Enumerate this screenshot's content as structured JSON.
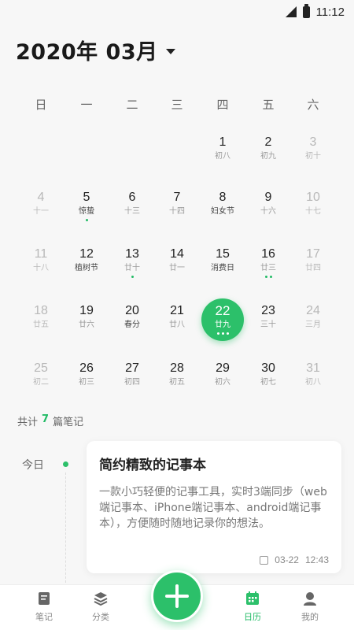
{
  "status_bar": {
    "time": "11:12"
  },
  "header": {
    "month_title": "2020年 03月"
  },
  "weekdays": [
    "日",
    "一",
    "二",
    "三",
    "四",
    "五",
    "六"
  ],
  "calendar": [
    [
      null,
      null,
      null,
      null,
      {
        "day": "1",
        "lunar": "初八",
        "muted": false,
        "dots": 0
      },
      {
        "day": "2",
        "lunar": "初九",
        "muted": false,
        "dots": 0
      },
      {
        "day": "3",
        "lunar": "初十",
        "muted": true,
        "dots": 0
      }
    ],
    [
      {
        "day": "4",
        "lunar": "十一",
        "muted": true,
        "dots": 0
      },
      {
        "day": "5",
        "lunar": "惊蛰",
        "muted": false,
        "dots": 1,
        "dark": true
      },
      {
        "day": "6",
        "lunar": "十三",
        "muted": false,
        "dots": 0
      },
      {
        "day": "7",
        "lunar": "十四",
        "muted": false,
        "dots": 0
      },
      {
        "day": "8",
        "lunar": "妇女节",
        "muted": false,
        "dots": 0,
        "dark": true
      },
      {
        "day": "9",
        "lunar": "十六",
        "muted": false,
        "dots": 0
      },
      {
        "day": "10",
        "lunar": "十七",
        "muted": true,
        "dots": 0
      }
    ],
    [
      {
        "day": "11",
        "lunar": "十八",
        "muted": true,
        "dots": 0
      },
      {
        "day": "12",
        "lunar": "植树节",
        "muted": false,
        "dots": 0,
        "dark": true
      },
      {
        "day": "13",
        "lunar": "廿十",
        "muted": false,
        "dots": 1
      },
      {
        "day": "14",
        "lunar": "廿一",
        "muted": false,
        "dots": 0
      },
      {
        "day": "15",
        "lunar": "消费日",
        "muted": false,
        "dots": 0,
        "dark": true
      },
      {
        "day": "16",
        "lunar": "廿三",
        "muted": false,
        "dots": 2
      },
      {
        "day": "17",
        "lunar": "廿四",
        "muted": true,
        "dots": 0
      }
    ],
    [
      {
        "day": "18",
        "lunar": "廿五",
        "muted": true,
        "dots": 0
      },
      {
        "day": "19",
        "lunar": "廿六",
        "muted": false,
        "dots": 0
      },
      {
        "day": "20",
        "lunar": "春分",
        "muted": false,
        "dots": 0,
        "dark": true
      },
      {
        "day": "21",
        "lunar": "廿八",
        "muted": false,
        "dots": 0
      },
      {
        "day": "22",
        "lunar": "廿九",
        "muted": false,
        "dots": 3,
        "selected": true
      },
      {
        "day": "23",
        "lunar": "三十",
        "muted": false,
        "dots": 0
      },
      {
        "day": "24",
        "lunar": "三月",
        "muted": true,
        "dots": 0
      }
    ],
    [
      {
        "day": "25",
        "lunar": "初二",
        "muted": true,
        "dots": 0
      },
      {
        "day": "26",
        "lunar": "初三",
        "muted": false,
        "dots": 0
      },
      {
        "day": "27",
        "lunar": "初四",
        "muted": false,
        "dots": 0
      },
      {
        "day": "28",
        "lunar": "初五",
        "muted": false,
        "dots": 0
      },
      {
        "day": "29",
        "lunar": "初六",
        "muted": false,
        "dots": 0
      },
      {
        "day": "30",
        "lunar": "初七",
        "muted": false,
        "dots": 0
      },
      {
        "day": "31",
        "lunar": "初八",
        "muted": true,
        "dots": 0
      }
    ]
  ],
  "summary": {
    "prefix": "共计",
    "count": "7",
    "suffix": "篇笔记"
  },
  "timeline": {
    "label": "今日"
  },
  "note": {
    "title": "简约精致的记事本",
    "body": "一款小巧轻便的记事工具，实时3端同步（web端记事本、iPhone端记事本、android端记事本），方便随时随地记录你的想法。",
    "date": "03-22",
    "time": "12:43"
  },
  "nav": {
    "notes": "笔记",
    "categories": "分类",
    "calendar": "日历",
    "mine": "我的"
  },
  "colors": {
    "accent": "#2cc06a"
  }
}
